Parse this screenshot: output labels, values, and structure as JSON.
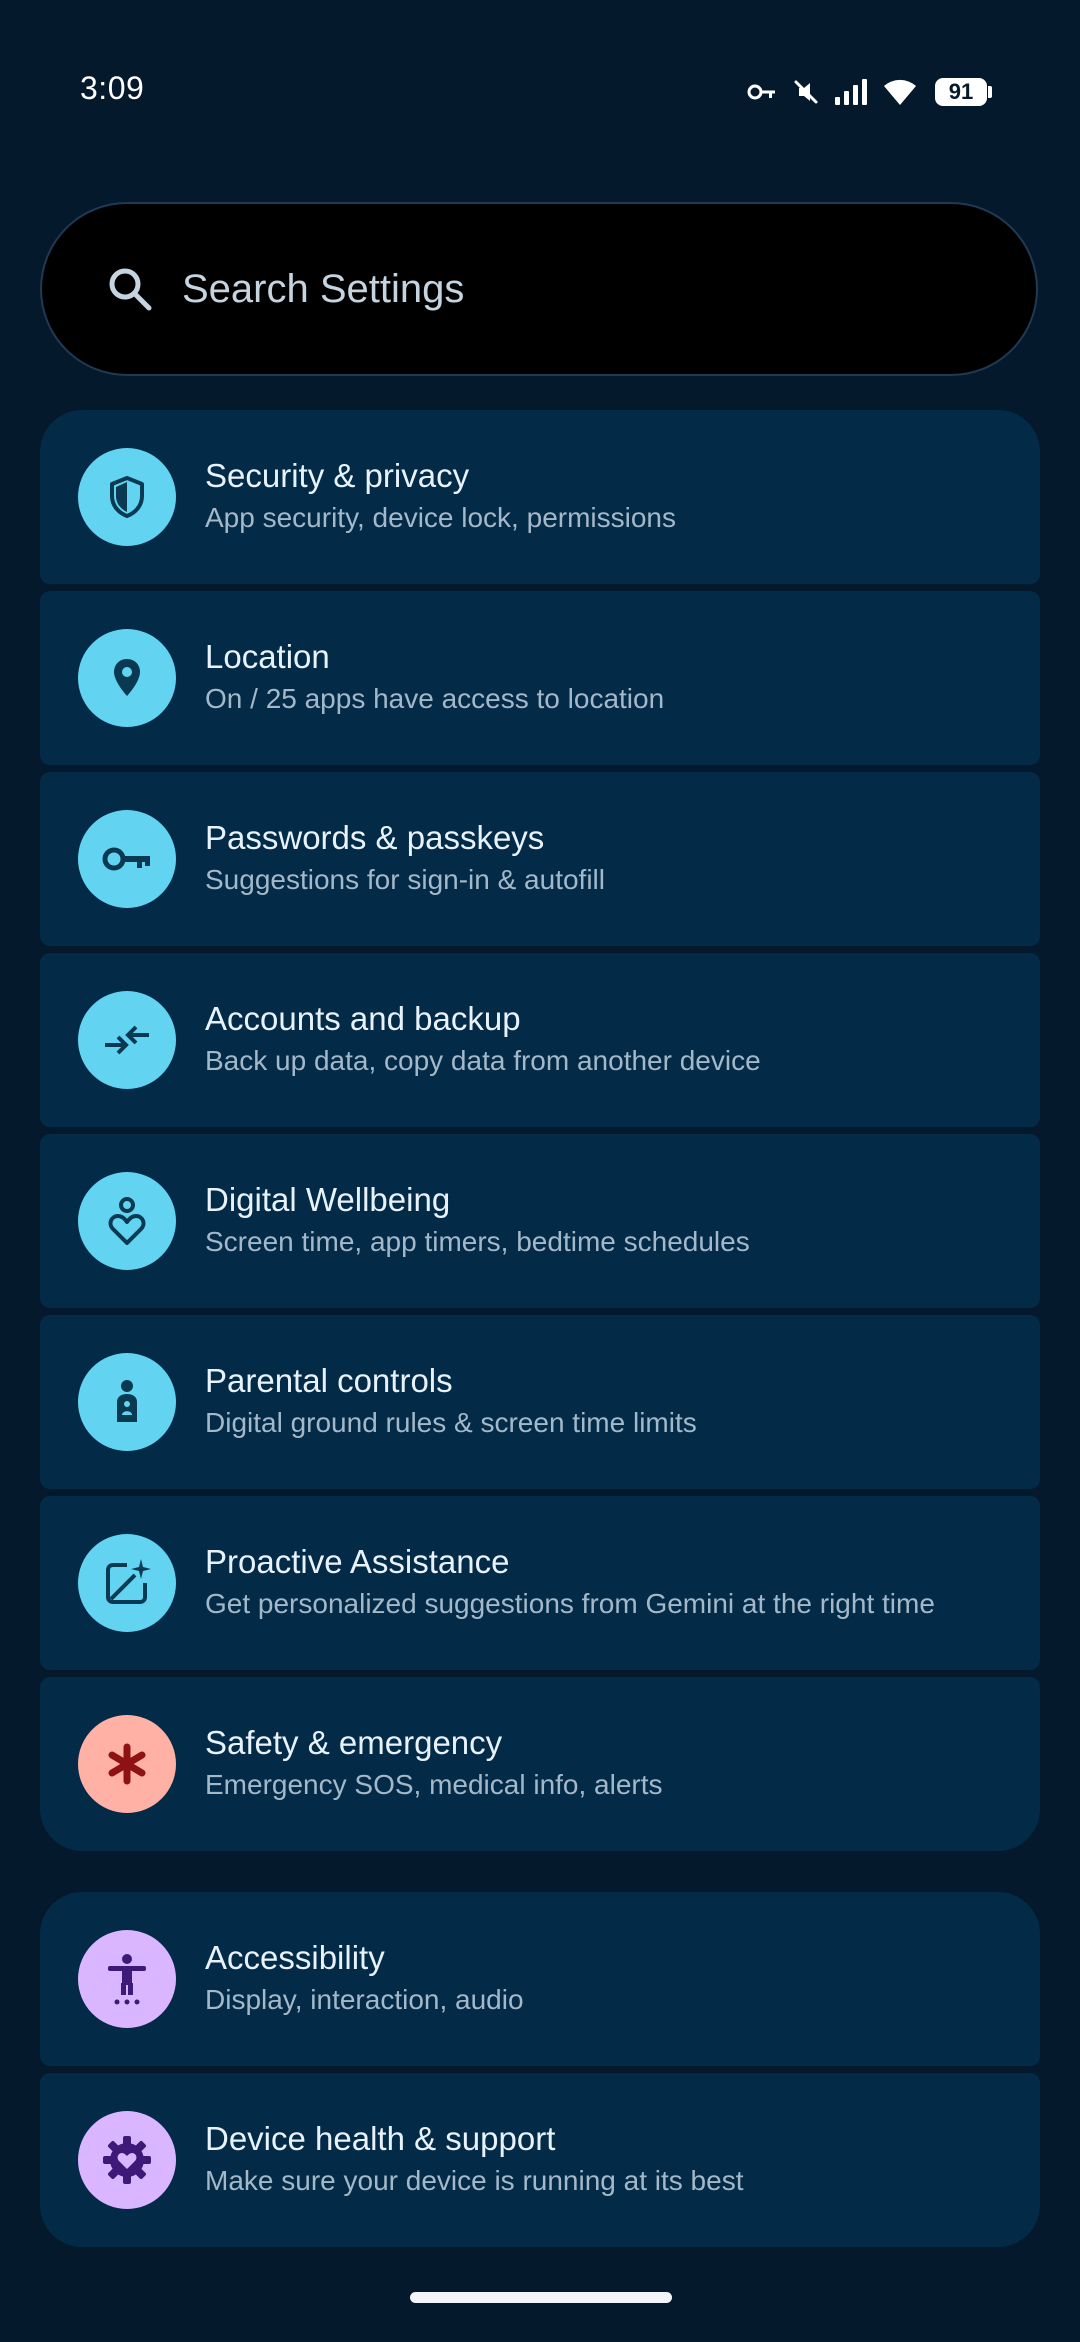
{
  "status": {
    "time": "3:09",
    "battery": "91",
    "icons": [
      "vpn-key-icon",
      "mute-icon",
      "signal-icon",
      "wifi-icon",
      "battery-icon"
    ]
  },
  "search": {
    "placeholder": "Search Settings",
    "icon": "search-icon"
  },
  "colors": {
    "background": "#04192b",
    "card": "#032a47",
    "icon_blue": "#62d4f2",
    "icon_red": "#ffb1a5",
    "icon_purple": "#d9b6ff"
  },
  "groups": [
    {
      "items": [
        {
          "title": "Security & privacy",
          "subtitle": "App security, device lock, permissions",
          "icon": "shield-icon"
        },
        {
          "title": "Location",
          "subtitle": "On / 25 apps have access to location",
          "icon": "location-pin-icon"
        },
        {
          "title": "Passwords & passkeys",
          "subtitle": "Suggestions for sign-in & autofill",
          "icon": "key-icon"
        },
        {
          "title": "Accounts and backup",
          "subtitle": "Back up data, copy data from another device",
          "icon": "sync-arrows-icon"
        },
        {
          "title": "Digital Wellbeing",
          "subtitle": "Screen time, app timers, bedtime schedules",
          "icon": "wellbeing-heart-icon"
        },
        {
          "title": "Parental controls",
          "subtitle": "Digital ground rules & screen time limits",
          "icon": "child-icon"
        },
        {
          "title": "Proactive Assistance",
          "subtitle": "Get personalized suggestions from Gemini at the right time",
          "icon": "sparkle-edit-icon"
        },
        {
          "title": "Safety & emergency",
          "subtitle": "Emergency SOS, medical info, alerts",
          "icon": "medical-asterisk-icon"
        }
      ]
    },
    {
      "items": [
        {
          "title": "Accessibility",
          "subtitle": "Display, interaction, audio",
          "icon": "accessibility-icon"
        },
        {
          "title": "Device health & support",
          "subtitle": "Make sure your device is running at its best",
          "icon": "gear-heart-icon"
        }
      ]
    }
  ]
}
